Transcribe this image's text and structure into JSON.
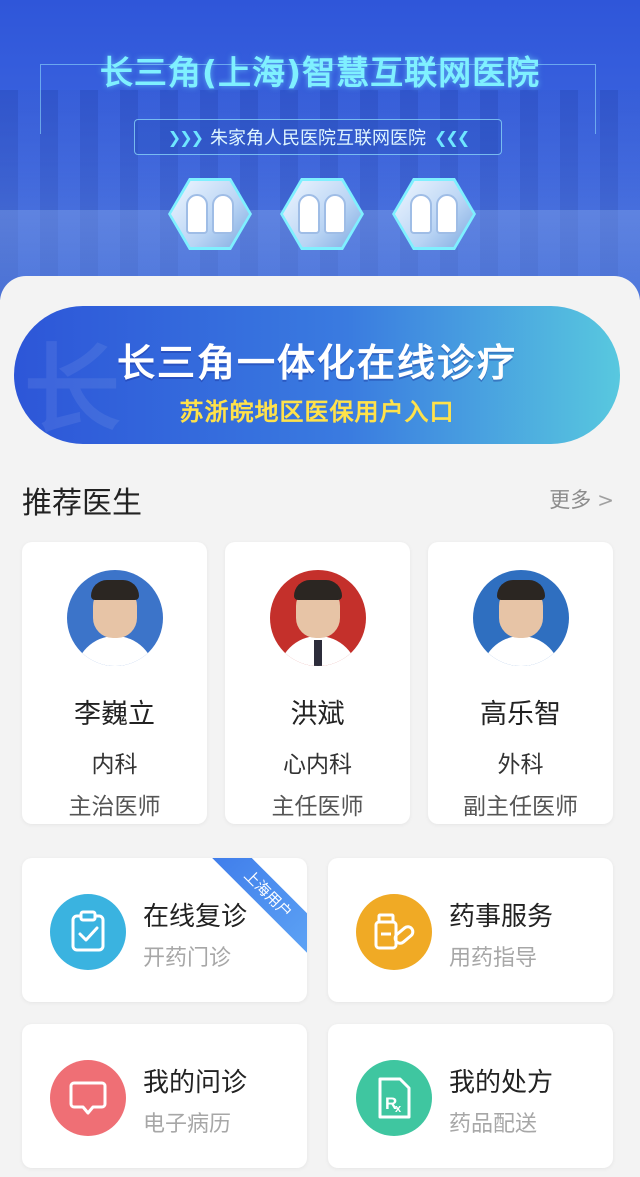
{
  "header": {
    "title": "长三角(上海)智慧互联网医院",
    "subtitle": "朱家角人民医院互联网医院",
    "chevrons_left": "❯❯❯",
    "chevrons_right": "❮❮❮"
  },
  "promo": {
    "title": "长三角一体化在线诊疗",
    "subtitle": "苏浙皖地区医保用户入口",
    "watermark": "长"
  },
  "recommend": {
    "title": "推荐医生",
    "more": "更多"
  },
  "doctors": [
    {
      "name": "李巍立",
      "dept": "内科",
      "title": "主治医师",
      "bg": "#3c74c9"
    },
    {
      "name": "洪斌",
      "dept": "心内科",
      "title": "主任医师",
      "bg": "#c4302b"
    },
    {
      "name": "高乐智",
      "dept": "外科",
      "title": "副主任医师",
      "bg": "#2f6fc0"
    }
  ],
  "services": [
    {
      "label": "在线复诊",
      "sub": "开药门诊",
      "color": "#3ab3e0",
      "icon": "clipboard-icon",
      "ribbon": "上海用户"
    },
    {
      "label": "药事服务",
      "sub": "用药指导",
      "color": "#f0aa25",
      "icon": "pills-icon"
    },
    {
      "label": "我的问诊",
      "sub": "电子病历",
      "color": "#ef6f75",
      "icon": "chat-icon"
    },
    {
      "label": "我的处方",
      "sub": "药品配送",
      "color": "#3fc6a0",
      "icon": "prescription-icon"
    }
  ]
}
